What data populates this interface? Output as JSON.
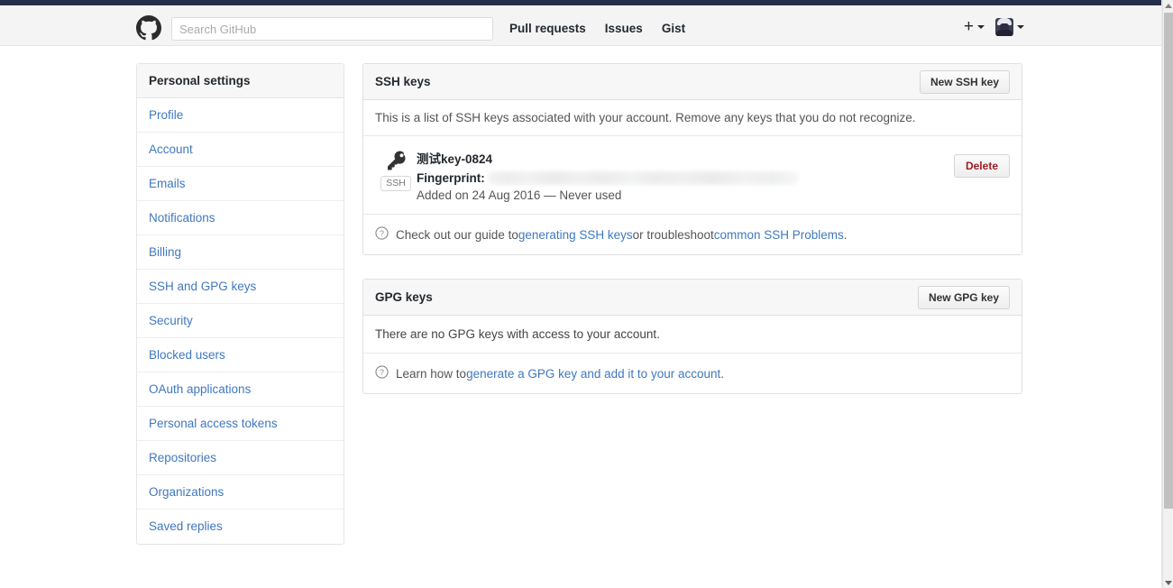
{
  "header": {
    "logo_icon": "github-octocat-icon",
    "search": {
      "placeholder": "Search GitHub",
      "value": ""
    },
    "nav": [
      {
        "label": "Pull requests"
      },
      {
        "label": "Issues"
      },
      {
        "label": "Gist"
      }
    ],
    "create_new": {
      "label": "+",
      "icon": "plus-icon",
      "caret": "chevron-down-icon"
    },
    "account": {
      "icon": "avatar-icon",
      "caret": "chevron-down-icon"
    }
  },
  "sidebar": {
    "title": "Personal settings",
    "items": [
      {
        "label": "Profile"
      },
      {
        "label": "Account"
      },
      {
        "label": "Emails"
      },
      {
        "label": "Notifications"
      },
      {
        "label": "Billing"
      },
      {
        "label": "SSH and GPG keys"
      },
      {
        "label": "Security"
      },
      {
        "label": "Blocked users"
      },
      {
        "label": "OAuth applications"
      },
      {
        "label": "Personal access tokens"
      },
      {
        "label": "Repositories"
      },
      {
        "label": "Organizations"
      },
      {
        "label": "Saved replies"
      }
    ]
  },
  "ssh_panel": {
    "title": "SSH keys",
    "new_button": "New SSH key",
    "intro": "This is a list of SSH keys associated with your account. Remove any keys that you do not recognize.",
    "key": {
      "icon": "key-icon",
      "badge": "SSH",
      "title": "测试key-0824",
      "fingerprint_label": "Fingerprint:",
      "fingerprint_value": "",
      "added": "Added on 24 Aug 2016 — Never used",
      "delete_button": "Delete"
    },
    "footer": {
      "icon": "question-circle-icon",
      "text_before": "Check out our guide to ",
      "link1": "generating SSH keys",
      "text_middle": " or troubleshoot ",
      "link2": "common SSH Problems",
      "text_after": "."
    }
  },
  "gpg_panel": {
    "title": "GPG keys",
    "new_button": "New GPG key",
    "empty": "There are no GPG keys with access to your account.",
    "footer": {
      "icon": "question-circle-icon",
      "text_before": "Learn how to ",
      "link1": "generate a GPG key and add it to your account",
      "text_after": "."
    }
  },
  "scrollbar": {
    "up_icon": "scroll-up-arrow-icon",
    "down_icon": "scroll-down-arrow-icon"
  },
  "colors": {
    "link": "#4078c0",
    "danger": "#9e1c23",
    "topbar": "#24304b",
    "text": "#24292e"
  }
}
